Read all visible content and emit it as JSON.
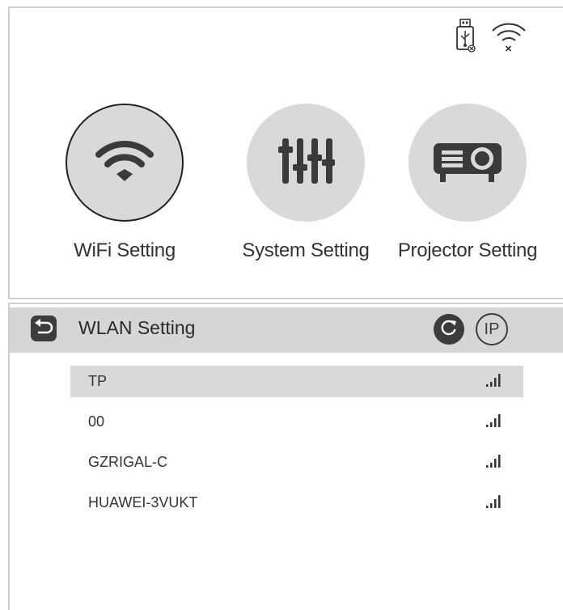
{
  "status_bar": {
    "usb_icon": "usb-drive-icon",
    "wifi_icon": "wifi-disconnected-icon"
  },
  "menu": {
    "items": [
      {
        "label": "WiFi Setting",
        "icon": "wifi-icon",
        "selected": true
      },
      {
        "label": "System Setting",
        "icon": "sliders-icon",
        "selected": false
      },
      {
        "label": "Projector Setting",
        "icon": "projector-icon",
        "selected": false
      }
    ]
  },
  "wlan": {
    "title": "WLAN Setting",
    "back_icon": "back-arrow-icon",
    "refresh_icon": "refresh-icon",
    "ip_label": "IP",
    "networks": [
      {
        "ssid": "TP",
        "selected": true,
        "signal_icon": "signal-strength-icon"
      },
      {
        "ssid": "00",
        "selected": false,
        "signal_icon": "signal-strength-icon"
      },
      {
        "ssid": "GZRIGAL-C",
        "selected": false,
        "signal_icon": "signal-strength-icon"
      },
      {
        "ssid": "HUAWEI-3VUKT",
        "selected": false,
        "signal_icon": "signal-strength-icon"
      }
    ]
  },
  "colors": {
    "tile_bg": "#d9d9d9",
    "header_bg": "#d6d6d6",
    "dark_icon": "#3c3c3c",
    "selected_row": "#d9d9d9"
  }
}
